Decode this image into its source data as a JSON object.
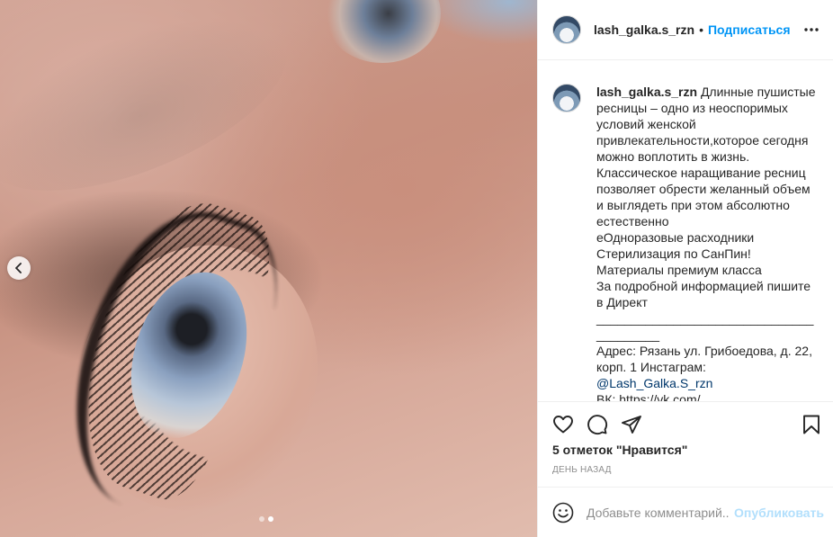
{
  "post": {
    "photo_alt": "eyelash extension close-up",
    "carousel": {
      "total_slides": 2,
      "active_slide": 2
    }
  },
  "header": {
    "username": "lash_galka.s_rzn",
    "separator": "•",
    "follow_label": "Подписаться",
    "more_icon": "more-horizontal-icon"
  },
  "caption": {
    "username": "lash_galka.s_rzn",
    "text_before_tag": " Длинные пушистые ресницы – одно из неоспоримых условий женской привлекательности,которое сегодня можно воплотить в жизнь. Классическое наращивание ресниц позволяет обрести желанный объем и выглядеть при этом абсолютно естественно\nеОдноразовые расходники\nСтерилизация по СанПин!\nМатериалы премиум класса\nЗа подробной информацией пишите в Директ\n________________________________________\nАдрес: Рязань ул. Грибоедова, д. 22, корп. 1 Инстаграм: ",
    "tag": "@Lash_Galka.S_rzn",
    "text_after_tag": "\nВК: https://vk.com/..."
  },
  "actions": {
    "like_icon": "heart-icon",
    "comment_icon": "comment-icon",
    "share_icon": "share-icon",
    "save_icon": "bookmark-icon"
  },
  "likes_text": "5 отметок \"Нравится\"",
  "timestamp": "день назад",
  "comment": {
    "placeholder": "Добавьте комментарий...",
    "value": "",
    "post_label": "Опубликовать",
    "emoji_icon": "emoji-icon"
  },
  "colors": {
    "accent": "#0095f6",
    "post_disabled": "#b2dffc",
    "text": "#262626",
    "muted": "#8e8e8e"
  }
}
